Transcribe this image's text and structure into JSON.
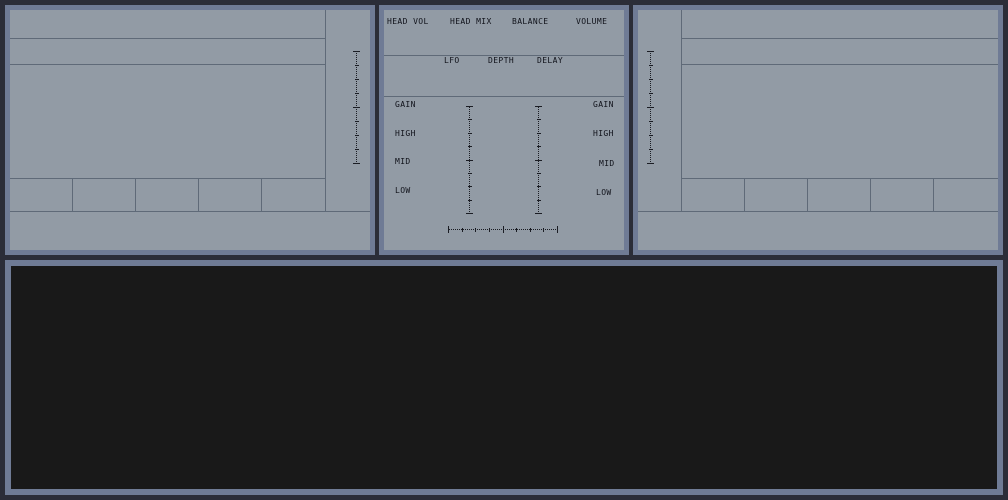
{
  "mixer": {
    "top_labels": [
      "HEAD VOL",
      "HEAD MIX",
      "BALANCE",
      "VOLUME"
    ],
    "fx_labels": [
      "LFO",
      "DEPTH",
      "DELAY"
    ],
    "eq_left": [
      "GAIN",
      "HIGH",
      "MID",
      "LOW"
    ],
    "eq_right": [
      "GAIN",
      "HIGH",
      "MID",
      "LOW"
    ]
  },
  "colors": {
    "background": "#2b2d38",
    "panel_frame": "#6f7b95",
    "panel_face": "#929ba5",
    "display": "#191919"
  }
}
